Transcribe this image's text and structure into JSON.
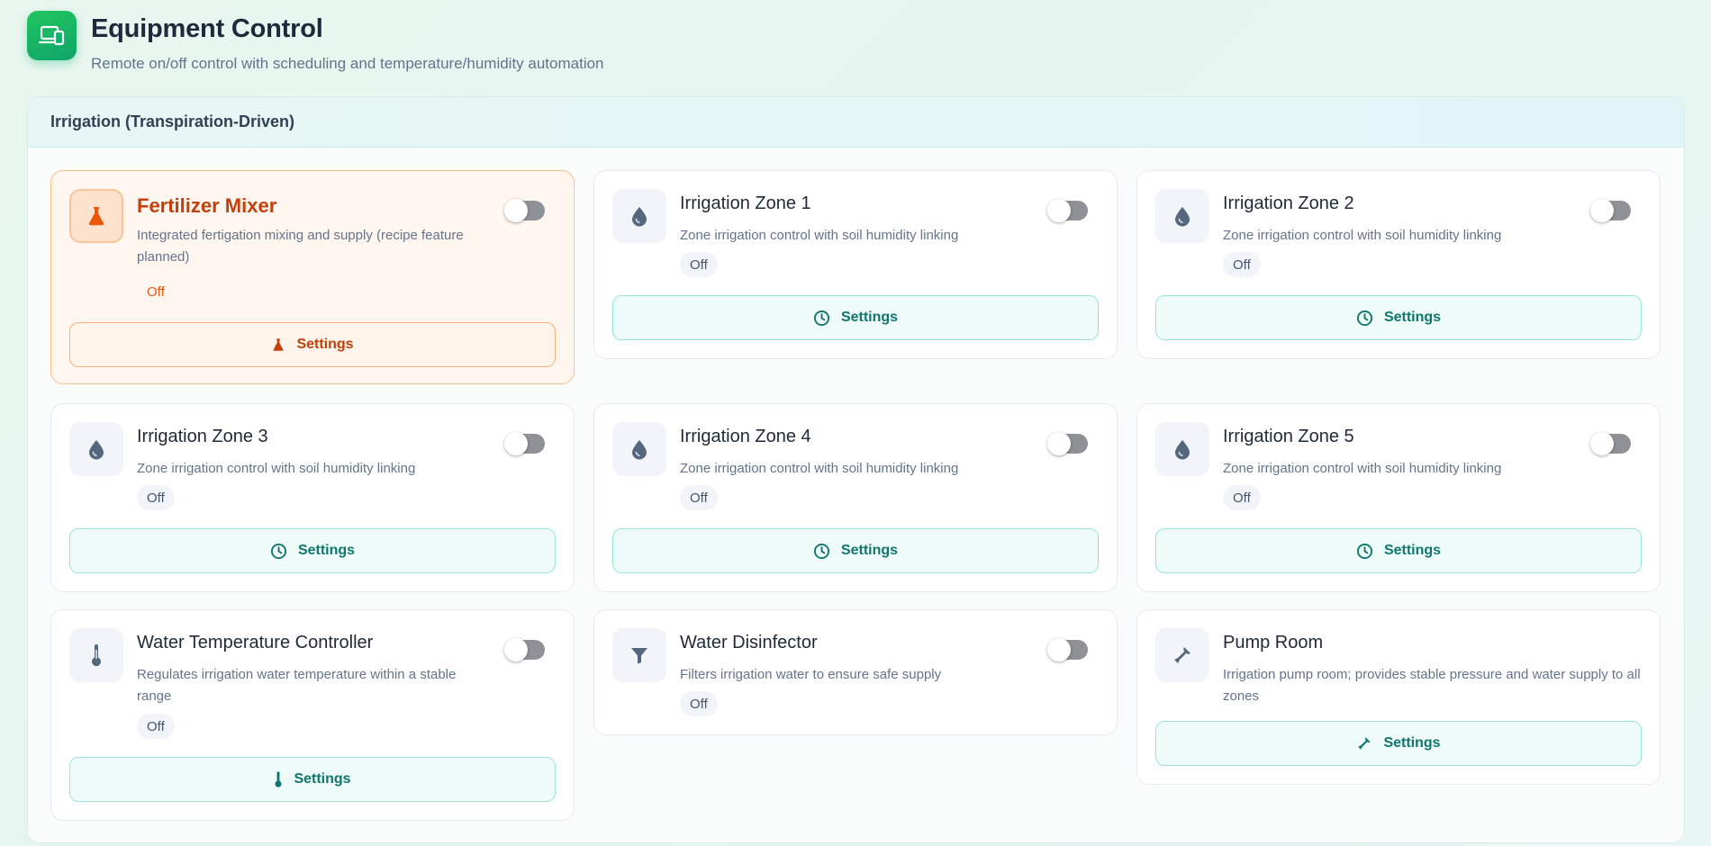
{
  "header": {
    "title": "Equipment Control",
    "subtitle": "Remote on/off control with scheduling and temperature/humidity automation"
  },
  "section": {
    "title": "Irrigation (Transpiration-Driven)"
  },
  "colors": {
    "accent_green": "#10b981",
    "featured_orange": "#c2410c",
    "toggle_off": "#8e9196",
    "settings_teal": "#0f766e"
  },
  "devices": [
    {
      "title": "Fertilizer Mixer",
      "description": "Integrated fertigation mixing and supply (recipe feature planned)",
      "status": "Off",
      "toggle_on": false,
      "icon": "flask-icon",
      "button_label": "Settings",
      "button_icon": "flask-icon"
    },
    {
      "title": "Irrigation Zone 1",
      "description": "Zone irrigation control with soil humidity linking",
      "status": "Off",
      "toggle_on": false,
      "icon": "water-drop-icon",
      "button_label": "Settings",
      "button_icon": "clock-icon"
    },
    {
      "title": "Irrigation Zone 2",
      "description": "Zone irrigation control with soil humidity linking",
      "status": "Off",
      "toggle_on": false,
      "icon": "water-drop-icon",
      "button_label": "Settings",
      "button_icon": "clock-icon"
    },
    {
      "title": "Irrigation Zone 3",
      "description": "Zone irrigation control with soil humidity linking",
      "status": "Off",
      "toggle_on": false,
      "icon": "water-drop-icon",
      "button_label": "Settings",
      "button_icon": "clock-icon"
    },
    {
      "title": "Irrigation Zone 4",
      "description": "Zone irrigation control with soil humidity linking",
      "status": "Off",
      "toggle_on": false,
      "icon": "water-drop-icon",
      "button_label": "Settings",
      "button_icon": "clock-icon"
    },
    {
      "title": "Irrigation Zone 5",
      "description": "Zone irrigation control with soil humidity linking",
      "status": "Off",
      "toggle_on": false,
      "icon": "water-drop-icon",
      "button_label": "Settings",
      "button_icon": "clock-icon"
    },
    {
      "title": "Water Temperature Controller",
      "description": "Regulates irrigation water temperature within a stable range",
      "status": "Off",
      "toggle_on": false,
      "icon": "thermometer-icon",
      "button_label": "Settings",
      "button_icon": "thermometer-icon"
    },
    {
      "title": "Water Disinfector",
      "description": "Filters irrigation water to ensure safe supply",
      "status": "Off",
      "toggle_on": false,
      "icon": "filter-funnel-icon"
    },
    {
      "title": "Pump Room",
      "description": "Irrigation pump room; provides stable pressure and water supply to all zones",
      "icon": "pipe-wrench-icon",
      "button_label": "Settings",
      "button_icon": "pipe-wrench-icon"
    }
  ]
}
